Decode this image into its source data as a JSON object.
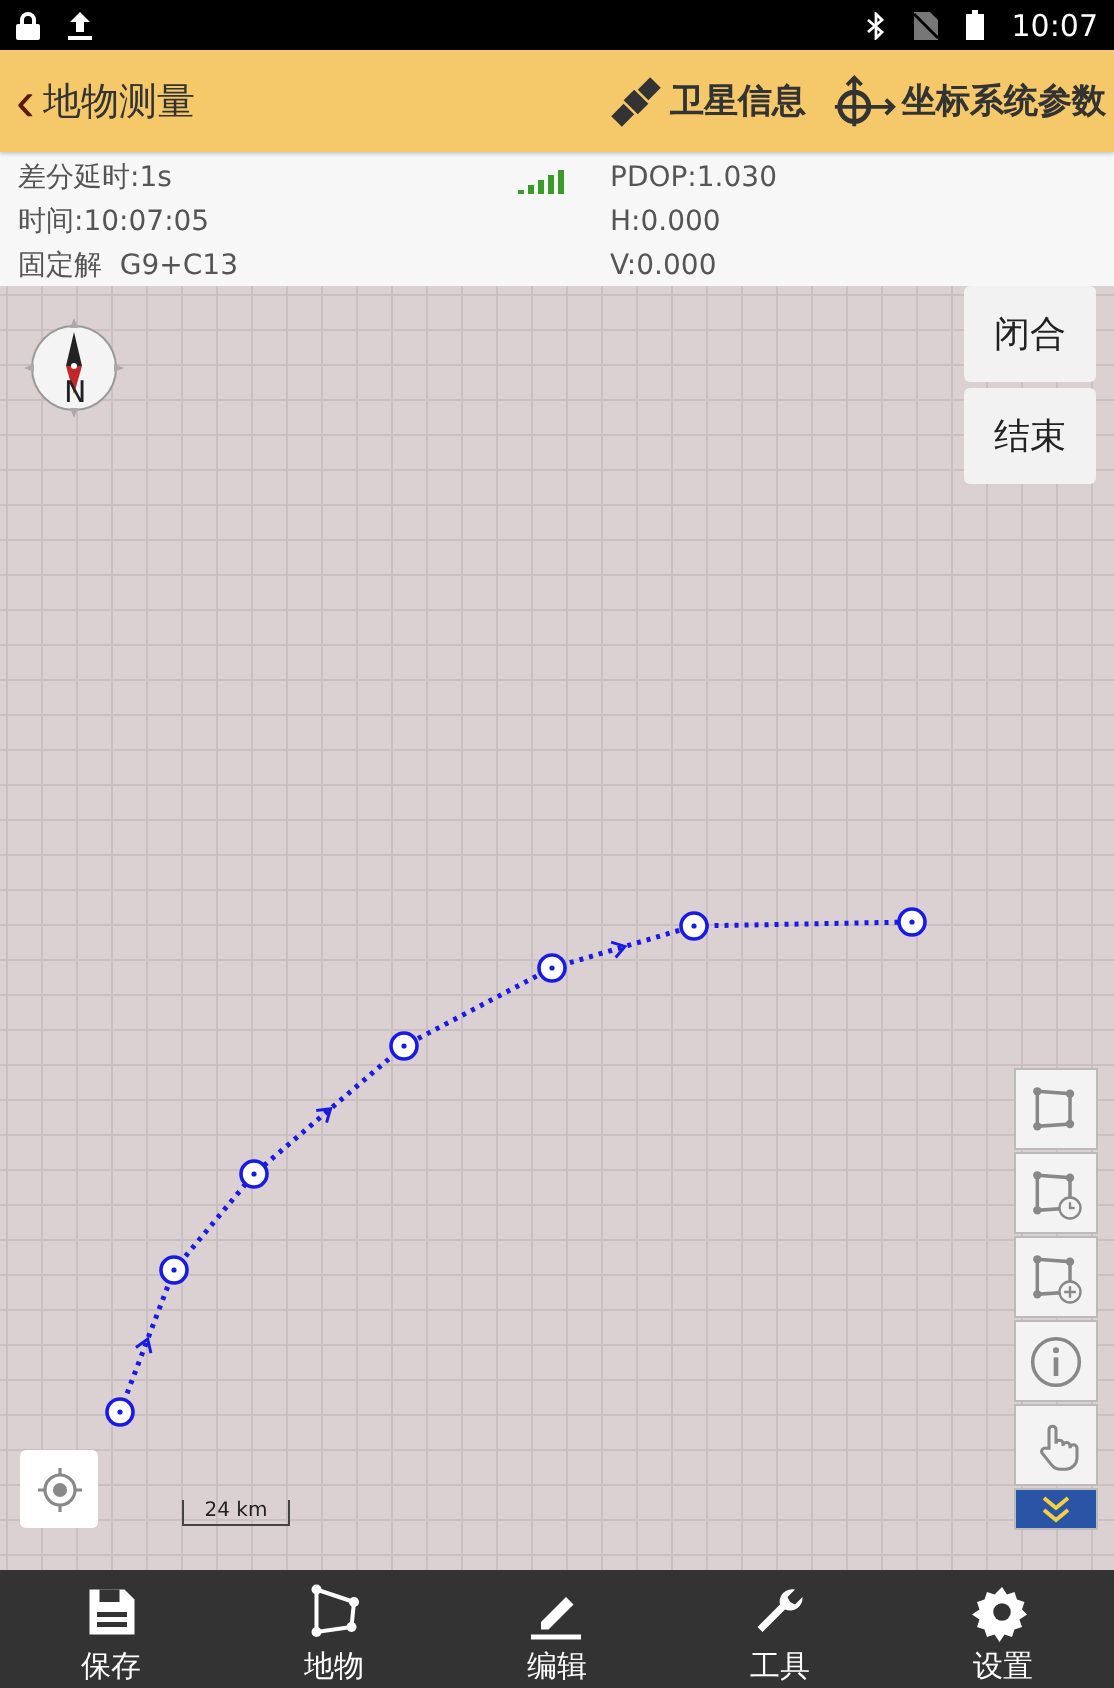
{
  "status_bar": {
    "time": "10:07"
  },
  "header": {
    "back": "‹",
    "title": "地物测量",
    "actions": [
      {
        "kind": "satellite",
        "label": "卫星信息"
      },
      {
        "kind": "coordinate",
        "label": "坐标系统参数"
      }
    ]
  },
  "info": {
    "left": [
      "差分延时:1s",
      "时间:10:07:05",
      "固定解  G9+C13"
    ],
    "right": [
      "PDOP:1.030",
      "H:0.000",
      "V:0.000"
    ]
  },
  "map": {
    "compass_label": "N",
    "buttons": [
      "闭合",
      "结束"
    ],
    "scale": "24 km",
    "tools": [
      {
        "kind": "polygon"
      },
      {
        "kind": "polygon-clock"
      },
      {
        "kind": "polygon-add"
      },
      {
        "kind": "info"
      },
      {
        "kind": "hand"
      },
      {
        "kind": "expand"
      }
    ]
  },
  "bottom_nav": [
    {
      "kind": "save",
      "label": "保存"
    },
    {
      "kind": "feature",
      "label": "地物"
    },
    {
      "kind": "edit",
      "label": "编辑"
    },
    {
      "kind": "tools",
      "label": "工具"
    },
    {
      "kind": "settings",
      "label": "设置"
    }
  ]
}
